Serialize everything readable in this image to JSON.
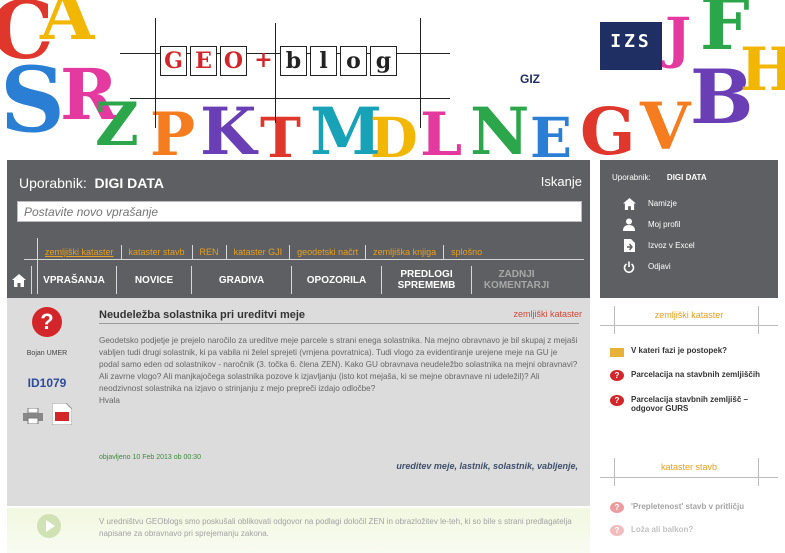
{
  "banner": {
    "logo_letters": [
      "G",
      "E",
      "O",
      "+",
      "b",
      "l",
      "o",
      "g"
    ],
    "izs_label": "IZS",
    "giz_label": "GIZ"
  },
  "user": {
    "label": "Uporabnik:",
    "name": "DIGI DATA",
    "search_label": "Iskanje"
  },
  "question_input": {
    "placeholder": "Postavite novo vprašanje"
  },
  "categories": [
    "zemljiški kataster",
    "kataster stavb",
    "REN",
    "kataster GJI",
    "geodetski načrt",
    "zemljiška knjiga",
    "splošno"
  ],
  "tabs": [
    "VPRAŠANJA",
    "NOVICE",
    "GRADIVA",
    "OPOZORILA",
    "PREDLOGI\nSPREMEMB",
    "ZADNJI\nKOMENTARJI"
  ],
  "sidebar": {
    "user_label": "Uporabnik:",
    "user_name": "DIGI DATA",
    "items": [
      {
        "label": "Namizje",
        "icon": "home-icon"
      },
      {
        "label": "Moj profil",
        "icon": "user-icon"
      },
      {
        "label": "Izvoz v Excel",
        "icon": "export-icon"
      },
      {
        "label": "Odjavi",
        "icon": "power-icon"
      }
    ]
  },
  "question": {
    "author": "Bojan UMER",
    "id": "ID1079",
    "title": "Neudeležba solastnika pri ureditvi meje",
    "category": "zemljiški kataster",
    "body": "Geodetsko podjetje je prejelo naročilo za ureditve meje parcele s strani enega solastnika. Na mejno obravnavo je bil skupaj z mejaši vabljen tudi drugi solastnik, ki pa vabila ni želel sprejeti (vrnjena povratnica). Tudi vlogo za evidentiranje urejene meje na GU je podal samo eden od solastnikov - naročnik (3. točka 6. člena ZEN). Kako GU obravnava neudeležbo solastnika na mejni obravnavi? Ali zavrne vlogo? Ali manjkajočega solastnika pozove k izjavljanju (isto kot mejaša, ki se mejne obravnave ni udeležil)? Ali neodzivnost solastnika na izjavo o strinjanju z mejo prepreči izdajo odločbe?",
    "thanks": "Hvala",
    "date": "objavljeno 10 Feb 2013 ob 00:30",
    "tags": "ureditev meje, lastnik, solastnik, vabljenje,"
  },
  "answer_preview": {
    "text": "V uredništvu GEOblogs smo poskušali oblikovati odgovor na podlagi določil ZEN in obrazložitev le-teh, ki so bile s strani predlagatelja napisane za obravnavo pri sprejemanju zakona."
  },
  "right_lists": [
    {
      "title": "zemljiški kataster",
      "items": [
        {
          "label": "V kateri fazi je postopek?",
          "icon": "folder-icon"
        },
        {
          "label": "Parcelacija na stavbnih zemljiščih",
          "icon": "question-icon"
        },
        {
          "label": "Parcelacija stavbnih zemljišč – odgovor GURS",
          "icon": "question-icon"
        }
      ]
    },
    {
      "title": "kataster stavb",
      "items": [
        {
          "label": "'Prepletenost' stavb v pritličju",
          "icon": "question-icon"
        },
        {
          "label": "Loža ali balkon?",
          "icon": "question-icon"
        }
      ]
    }
  ],
  "colors": {
    "panel": "#5d5f62",
    "accent_orange": "#e8a020",
    "category_red": "#d04838",
    "question_red": "#d3262b",
    "id_blue": "#2d4b9a",
    "izs_navy": "#1f2f63"
  }
}
